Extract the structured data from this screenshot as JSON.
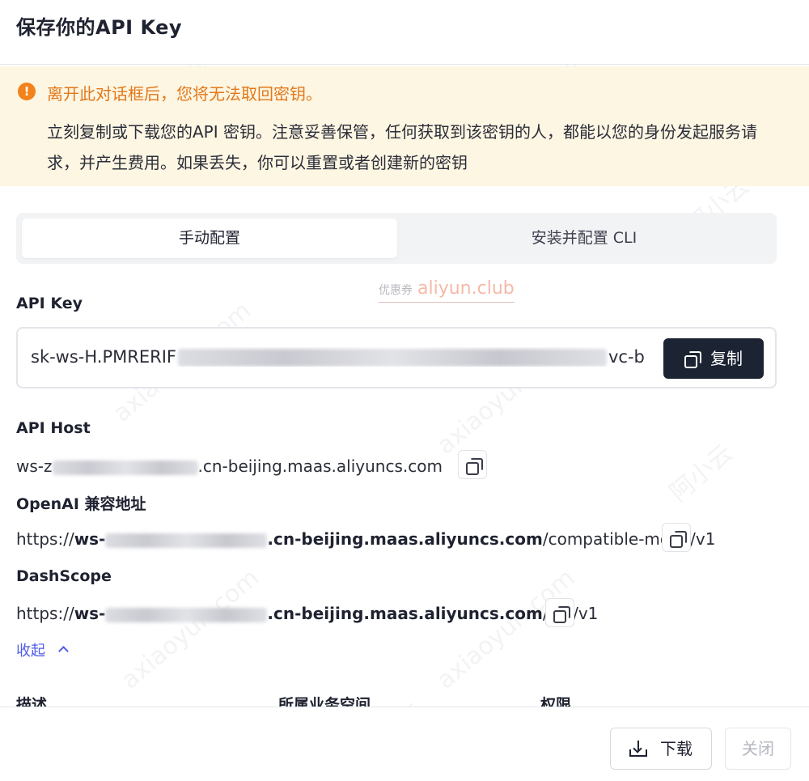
{
  "dialog": {
    "title": "保存你的API Key"
  },
  "warning": {
    "title": "离开此对话框后，您将无法取回密钥。",
    "body": "立刻复制或下载您的API 密钥。注意妥善保管，任何获取到该密钥的人，都能以您的身份发起服务请求，并产生费用。如果丢失，你可以重置或者创建新的密钥"
  },
  "tabs": [
    {
      "label": "手动配置",
      "active": true
    },
    {
      "label": "安装并配置 CLI",
      "active": false
    }
  ],
  "promo": {
    "small": "优惠券",
    "site": "aliyun.club"
  },
  "api_key": {
    "label": "API Key",
    "value_start": "sk-ws-H.PMRERIF",
    "value_end": "vc-b",
    "copy_label": "复制"
  },
  "api_host": {
    "label": "API Host",
    "prefix": "ws-z",
    "suffix": ".cn-beijing.maas.aliyuncs.com"
  },
  "openai": {
    "label": "OpenAI 兼容地址",
    "scheme": "https://",
    "host_prefix": "ws-",
    "host_suffix": ".cn-beijing.maas.aliyuncs.com",
    "path": "/compatible-mode/v1"
  },
  "dashscope": {
    "label": "DashScope",
    "scheme": "https://",
    "host_prefix": "ws-",
    "host_suffix": ".cn-beijing.maas.aliyuncs.com",
    "path": "/api/v1"
  },
  "collapse_label": "收起",
  "columns": [
    "描述",
    "所属业务空间",
    "权限"
  ],
  "footer": {
    "download_label": "下载",
    "close_label": "关闭"
  },
  "watermark": [
    "axiaoyun.com",
    "阿小云"
  ],
  "colors": {
    "primary_dark": "#1c2434",
    "warning_bg": "#fdf6e3",
    "warning_text": "#e2781a",
    "link": "#4f5de8"
  }
}
